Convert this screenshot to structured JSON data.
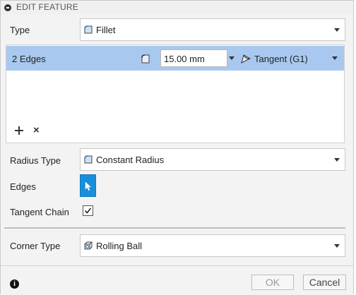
{
  "dialog": {
    "title": "EDIT FEATURE"
  },
  "type": {
    "label": "Type",
    "value": "Fillet",
    "icon": "fillet-icon"
  },
  "selection": {
    "label": "2 Edges",
    "radius_value": "15.00 mm",
    "continuity_value": "Tangent (G1)",
    "radius_icon": "radius-icon",
    "continuity_icon": "continuity-icon"
  },
  "radius_type": {
    "label": "Radius Type",
    "value": "Constant Radius",
    "icon": "constant-radius-icon"
  },
  "edges": {
    "label": "Edges",
    "icon": "cursor-arrow-icon"
  },
  "tangent_chain": {
    "label": "Tangent Chain",
    "checked": true
  },
  "corner_type": {
    "label": "Corner Type",
    "value": "Rolling Ball",
    "icon": "rolling-ball-icon"
  },
  "footer": {
    "ok_label": "OK",
    "cancel_label": "Cancel",
    "info_icon": "info-icon"
  },
  "colors": {
    "selection_row": "#a9c8ef",
    "edges_button": "#1a8fd9",
    "dialog_bg": "#f3f3f3"
  }
}
